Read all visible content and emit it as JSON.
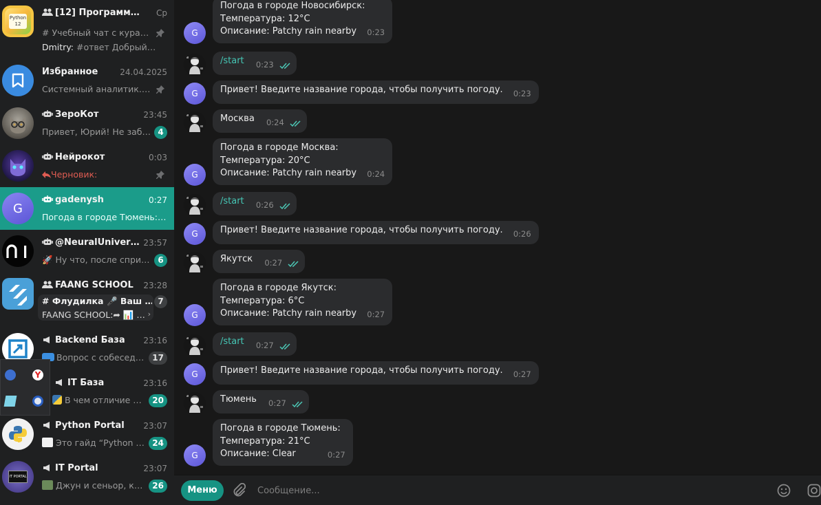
{
  "sidebar": {
    "chats": [
      {
        "title": "[12] Программиров…",
        "time": "Ср",
        "preview_line1": "# Учебный чат с курато…",
        "preview_line2_prefix": "Dmitry:",
        "preview_line2": "#ответ  Добрый…",
        "avatar_text": "Python 12",
        "pinned": true
      },
      {
        "title": "Избранное",
        "time": "24.04.2025",
        "preview": "Системный аналитик. А…",
        "pinned": true
      },
      {
        "title": "ЗероКот",
        "time": "23:45",
        "preview": "Привет, Юрий!  Не заб…",
        "badge": "4"
      },
      {
        "title": "Нейрокот",
        "time": "0:03",
        "draft_label": "Черновик:",
        "preview": "",
        "pinned": true
      },
      {
        "title": "gadenysh",
        "time": "0:27",
        "preview": "Погода в городе Тюмень: Т…",
        "avatar_text": "G"
      },
      {
        "title": "@NeuralUniversit…",
        "time": "23:57",
        "preview": "🚀 Ну что, после сприн…",
        "badge": "6"
      },
      {
        "title": "FAANG SCHOOL",
        "time": "23:28",
        "topic1": "# Флудилка",
        "topic2": "🎤 Ваш …",
        "preview": "FAANG SCHOOL:➦ 📊 …",
        "badge": "7"
      },
      {
        "title": "Backend База",
        "time": "23:16",
        "preview": "Вопрос с собеседо…",
        "badge": "17"
      },
      {
        "title": "IT База",
        "time": "23:16",
        "preview": "В чем отличие …",
        "badge": "20"
      },
      {
        "title": "Python Portal",
        "time": "23:07",
        "preview": "Это гайд “Python Lo…",
        "badge": "24"
      },
      {
        "title": "IT Portal",
        "time": "23:07",
        "preview": "Джун и сеньор, ког…",
        "badge": "26",
        "avatar_text": "IT PORTAL"
      }
    ]
  },
  "messages": [
    {
      "from": "bot",
      "lines": [
        "Погода в городе Новосибирск:",
        "Температура: 12°C",
        "Описание: Patchy rain nearby"
      ],
      "time": "0:23"
    },
    {
      "from": "user",
      "lines": [
        "/start"
      ],
      "time": "0:23",
      "command": true
    },
    {
      "from": "bot",
      "lines": [
        "Привет! Введите название города, чтобы получить погоду."
      ],
      "time": "0:23"
    },
    {
      "from": "user",
      "lines": [
        "Москва"
      ],
      "time": "0:24"
    },
    {
      "from": "bot",
      "lines": [
        "Погода в городе Москва:",
        "Температура: 20°C",
        "Описание: Patchy rain nearby"
      ],
      "time": "0:24"
    },
    {
      "from": "user",
      "lines": [
        "/start"
      ],
      "time": "0:26",
      "command": true
    },
    {
      "from": "bot",
      "lines": [
        "Привет! Введите название города, чтобы получить погоду."
      ],
      "time": "0:26"
    },
    {
      "from": "user",
      "lines": [
        "Якутск"
      ],
      "time": "0:27"
    },
    {
      "from": "bot",
      "lines": [
        "Погода в городе Якутск:",
        "Температура: 6°C",
        "Описание: Patchy rain nearby"
      ],
      "time": "0:27"
    },
    {
      "from": "user",
      "lines": [
        "/start"
      ],
      "time": "0:27",
      "command": true
    },
    {
      "from": "bot",
      "lines": [
        "Привет! Введите название города, чтобы получить погоду."
      ],
      "time": "0:27"
    },
    {
      "from": "user",
      "lines": [
        "Тюмень"
      ],
      "time": "0:27"
    },
    {
      "from": "bot",
      "lines": [
        "Погода в городе Тюмень:",
        "Температура: 21°C",
        "Описание: Clear"
      ],
      "time": "0:27"
    }
  ],
  "bot_avatar_letter": "G",
  "composer": {
    "menu_label": "Меню",
    "placeholder": "Сообщение..."
  },
  "colors": {
    "accent": "#169383",
    "active_chat": "#1b9c8a",
    "bubble": "#2b2c2e",
    "command": "#45c6b5",
    "draft": "#e05c52"
  },
  "icons": [
    "group-icon",
    "bookmark-icon",
    "bot-icon",
    "pin-icon",
    "channel-icon",
    "attach-icon",
    "emoji-icon",
    "camera-icon",
    "double-check-icon"
  ]
}
